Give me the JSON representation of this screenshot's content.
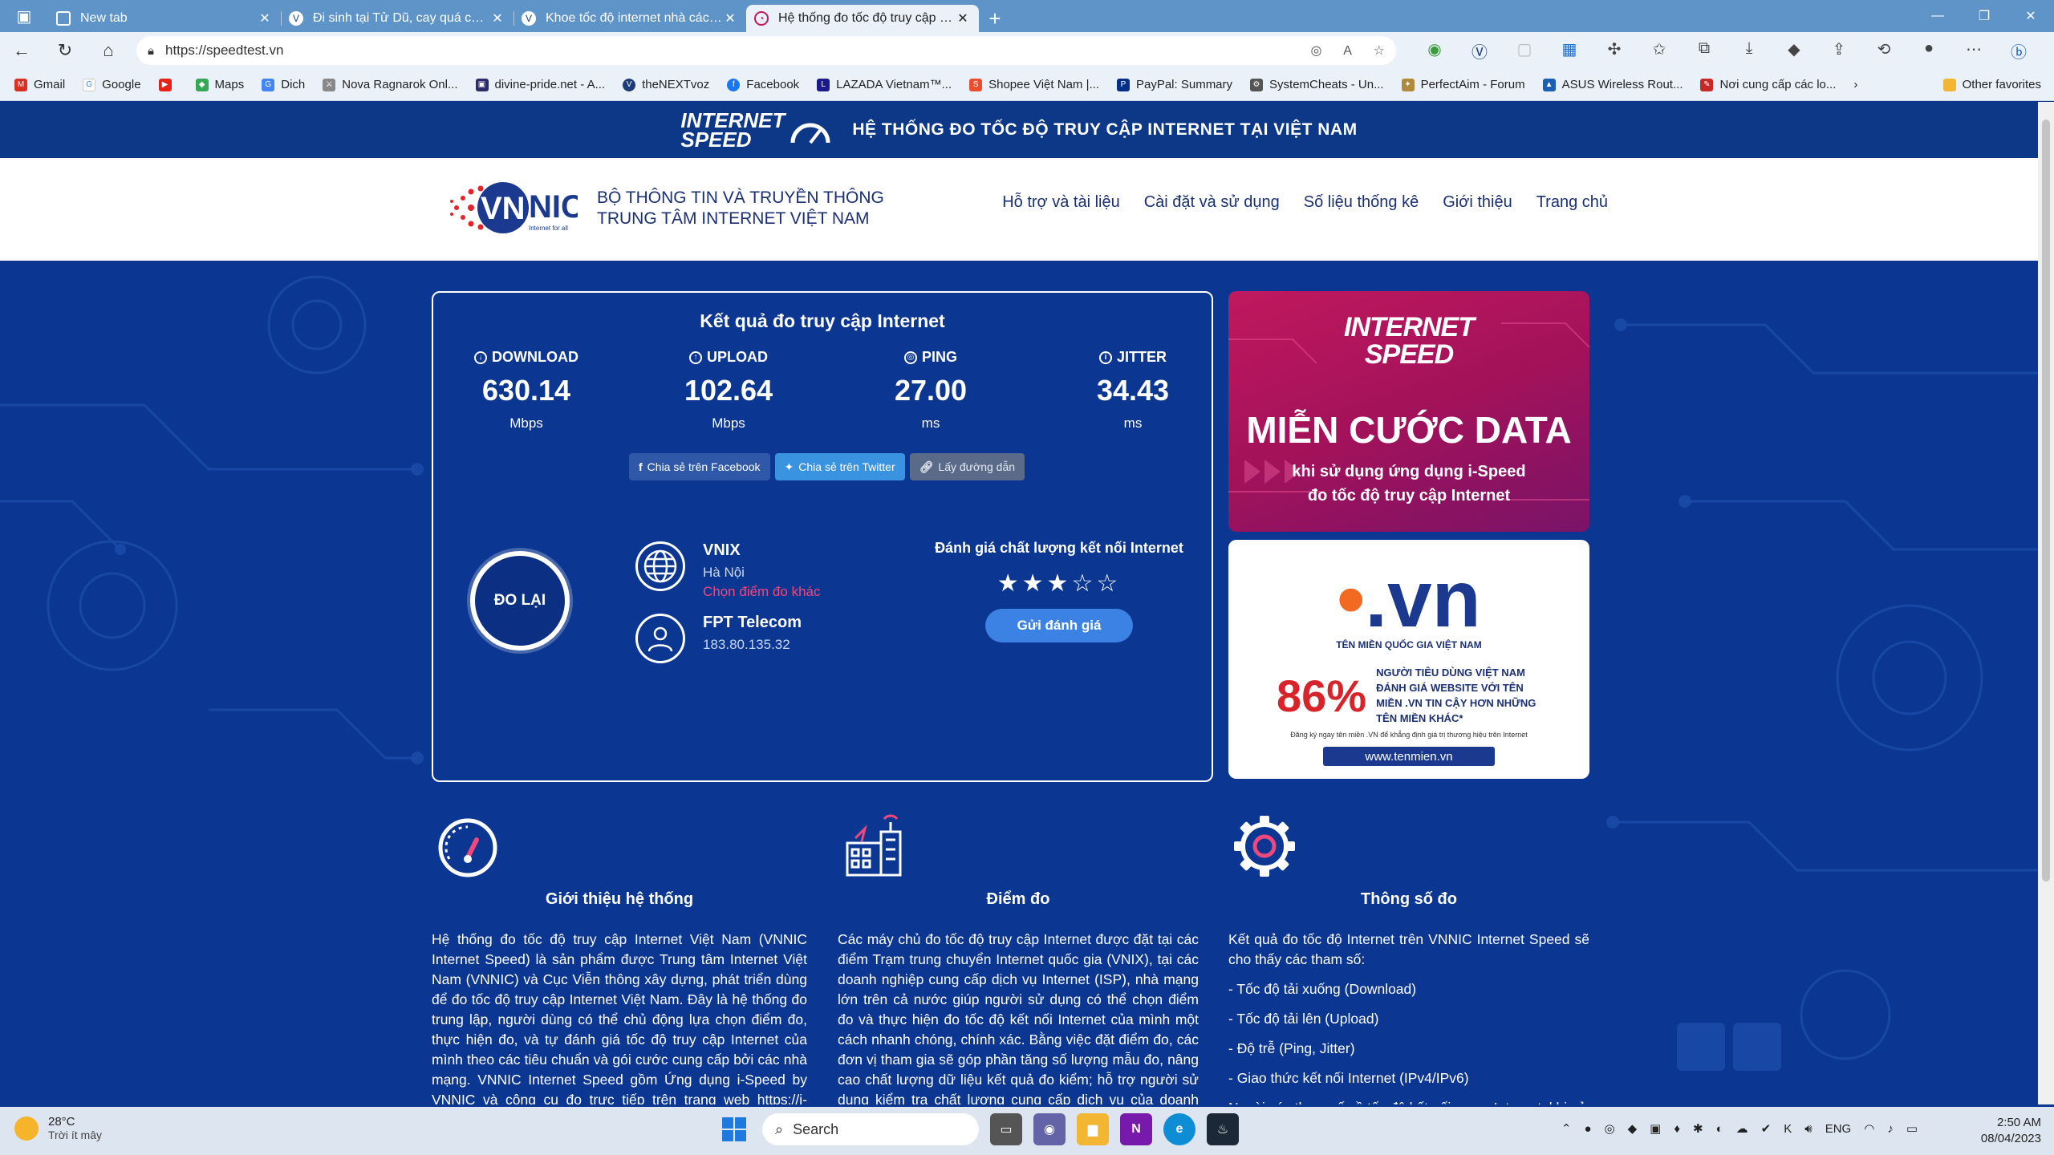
{
  "browser": {
    "tabs": [
      {
        "title": "New tab",
        "active": false
      },
      {
        "title": "Đi sinh tại Tử Dũ, cay quá các th",
        "active": false
      },
      {
        "title": "Khoe tốc độ internet nhà các thi",
        "active": false
      },
      {
        "title": "Hệ thống đo tốc độ truy cập Inte",
        "active": true
      }
    ],
    "url": "https://speedtest.vn",
    "bookmarks": [
      "Gmail",
      "Google",
      "",
      "Maps",
      "Dich",
      "Nova Ragnarok Onl...",
      "divine-pride.net - A...",
      "theNEXTvoz",
      "Facebook",
      "LAZADA Vietnam™...",
      "Shopee Việt Nam |...",
      "PayPal: Summary",
      "SystemCheats - Un...",
      "PerfectAim - Forum",
      "ASUS Wireless Rout...",
      "Nơi cung cấp các lo..."
    ],
    "other_favorites": "Other favorites"
  },
  "site": {
    "band_brand_line1": "INTERNET",
    "band_brand_line2": "SPEED",
    "band_title": "HỆ THỐNG ĐO TỐC ĐỘ TRUY CẬP INTERNET TẠI VIỆT NAM",
    "logo_text": "VNNIC",
    "logo_tagline": "Internet for all",
    "org_line1": "BỘ THÔNG TIN VÀ TRUYỀN THÔNG",
    "org_line2": "TRUNG TÂM INTERNET VIỆT NAM",
    "nav": [
      "Hỗ trợ và tài liệu",
      "Cài đặt và sử dụng",
      "Số liệu thống kê",
      "Giới thiệu",
      "Trang chủ"
    ]
  },
  "result": {
    "title": "Kết quả đo truy cập Internet",
    "metrics": [
      {
        "label": "DOWNLOAD",
        "value": "630.14",
        "unit": "Mbps"
      },
      {
        "label": "UPLOAD",
        "value": "102.64",
        "unit": "Mbps"
      },
      {
        "label": "PING",
        "value": "27.00",
        "unit": "ms"
      },
      {
        "label": "JITTER",
        "value": "34.43",
        "unit": "ms"
      }
    ],
    "share_facebook": "Chia sẻ trên Facebook",
    "share_twitter": "Chia sẻ trên Twitter",
    "share_link": "Lấy đường dẫn",
    "redo": "ĐO LẠI",
    "server_name": "VNIX",
    "server_city": "Hà Nội",
    "server_change": "Chọn điểm đo khác",
    "isp_name": "FPT Telecom",
    "isp_ip": "183.80.135.32",
    "rating_title": "Đánh giá chất lượng kết nối Internet",
    "rating_value": 3,
    "rating_max": 5,
    "send_rating": "Gửi đánh giá"
  },
  "ads": {
    "ad1_logo_line1": "INTERNET",
    "ad1_logo_line2": "SPEED",
    "ad1_headline": "MIỄN CƯỚC DATA",
    "ad1_sub1": "khi sử dụng ứng dụng i-Speed",
    "ad1_sub2": "đo tốc độ truy cập Internet",
    "ad2_domain": ".vn",
    "ad2_tag": "TÊN MIỀN QUỐC GIA VIỆT NAM",
    "ad2_percent": "86%",
    "ad2_text": "NGƯỜI TIÊU DÙNG VIỆT NAM ĐÁNH GIÁ WEBSITE VỚI TÊN MIỀN .VN TIN CẬY HƠN NHỮNG TÊN MIỀN KHÁC*",
    "ad2_fine": "Đăng ký ngay tên miền .VN để khẳng định giá trị thương hiệu trên Internet",
    "ad2_site": "www.tenmien.vn"
  },
  "features": [
    {
      "title": "Giới thiệu hệ thống",
      "body": "Hệ thống đo tốc độ truy cập Internet Việt Nam (VNNIC Internet Speed) là sản phẩm được Trung tâm Internet Việt Nam (VNNIC) và Cục Viễn thông xây dựng, phát triển dùng để đo tốc độ truy cập Internet Việt Nam. Đây là hệ thống đo trung lập, người dùng có thể chủ động lựa chọn điểm đo, thực hiện đo, và tự đánh giá tốc độ truy cập Internet của mình theo các tiêu chuẩn và gói cước cung cấp bởi các nhà mạng. VNNIC Internet Speed gồm Ứng dụng i-Speed by VNNIC và công cụ đo trực tiếp trên trang web https://i-speed.vn"
    },
    {
      "title": "Điểm đo",
      "body": "Các máy chủ đo tốc độ truy cập Internet được đặt tại các điểm Trạm trung chuyển Internet quốc gia (VNIX), tại các doanh nghiệp cung cấp dịch vụ Internet (ISP), nhà mạng lớn trên cả nước giúp người sử dụng có thể chọn điểm đo và thực hiện đo tốc độ kết nối Internet của mình một cách nhanh chóng, chính xác. Bằng việc đặt điểm đo, các đơn vị tham gia sẽ góp phần tăng số lượng mẫu đo, nâng cao chất lượng dữ liệu kết quả đo kiểm; hỗ trợ người sử dụng kiểm tra chất lượng cung cấp dịch vụ của doanh nghiệp;"
    },
    {
      "title": "Thông số đo",
      "body": "Kết quả đo tốc độ Internet trên VNNIC Internet Speed sẽ cho thấy các tham số:",
      "items": [
        "- Tốc độ tải xuống (Download)",
        "- Tốc độ tải lên (Upload)",
        "- Độ trễ (Ping, Jitter)",
        "- Giao thức kết nối Internet (IPv4/IPv6)",
        "Ngoài các tham số về tốc độ kết nối mạng Internet, khi sử"
      ]
    }
  ],
  "taskbar": {
    "temp": "28°C",
    "condition": "Trời ít mây",
    "search": "Search",
    "lang": "ENG",
    "time": "2:50 AM",
    "date": "08/04/2023"
  },
  "colors": {
    "page_bg": "#0b3691",
    "accent_pink": "#c0185e",
    "link_pink": "#f0487d",
    "button_blue": "#3b82e4"
  }
}
